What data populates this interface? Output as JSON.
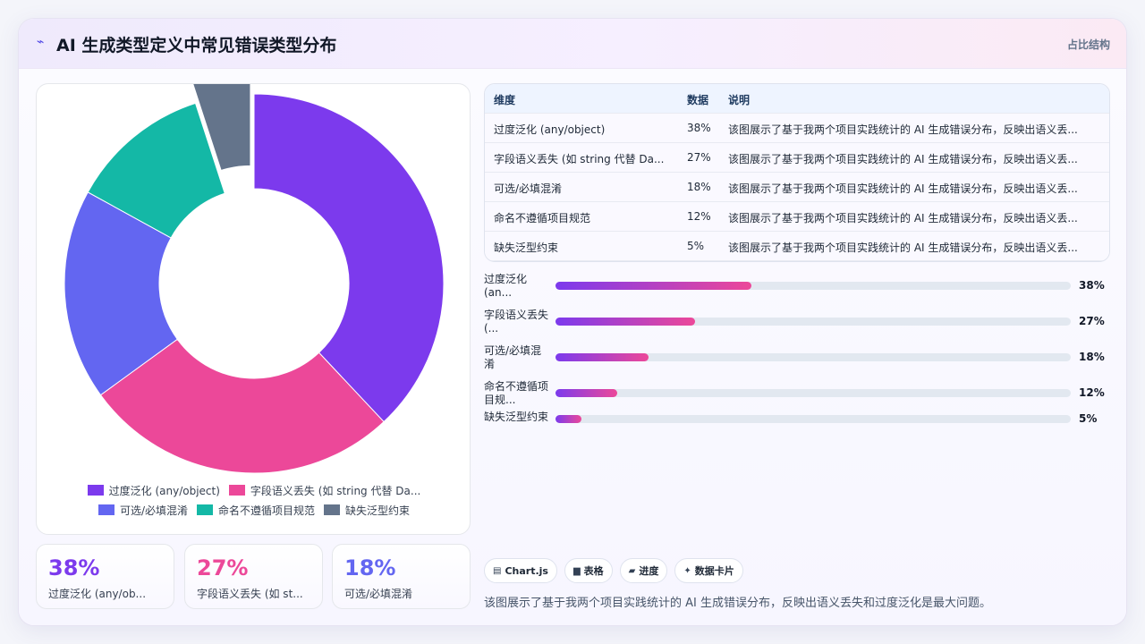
{
  "header": {
    "title": "AI 生成类型定义中常见错误类型分布",
    "badge": "占比结构",
    "logo_icon": "sparkle-icon"
  },
  "colors": {
    "accent": "#7c3aed",
    "pink": "#ec4899",
    "indigo": "#6366f1",
    "teal": "#14b8a6",
    "slate": "#64748b"
  },
  "chart_data": {
    "type": "pie",
    "variant": "doughnut",
    "categories": [
      "过度泛化 (any/object)",
      "字段语义丢失 (如 string 代替 Da...",
      "可选/必填混淆",
      "命名不遵循项目规范",
      "缺失泛型约束"
    ],
    "values": [
      38,
      27,
      18,
      12,
      5
    ],
    "colors": [
      "#7c3aed",
      "#ec4899",
      "#6366f1",
      "#14b8a6",
      "#64748b"
    ],
    "legend_labels": [
      "过度泛化 (any/object)",
      "字段语义丢失 (如 string 代替 Da...",
      "可选/必填混淆",
      "命名不遵循项目规范",
      "缺失泛型约束"
    ],
    "legend_position": "bottom",
    "highlight_offset_index": 4,
    "title": ""
  },
  "stats": [
    {
      "value": "38%",
      "label": "过度泛化 (any/ob...",
      "color": "#7c3aed"
    },
    {
      "value": "27%",
      "label": "字段语义丢失 (如 st...",
      "color": "#ec4899"
    },
    {
      "value": "18%",
      "label": "可选/必填混淆",
      "color": "#6366f1"
    }
  ],
  "table": {
    "headers": [
      "维度",
      "数据",
      "说明"
    ],
    "rows": [
      [
        "过度泛化 (any/object)",
        "38%",
        "该图展示了基于我两个项目实践统计的 AI 生成错误分布，反映出语义丢..."
      ],
      [
        "字段语义丢失 (如 string 代替 Da...",
        "27%",
        "该图展示了基于我两个项目实践统计的 AI 生成错误分布，反映出语义丢..."
      ],
      [
        "可选/必填混淆",
        "18%",
        "该图展示了基于我两个项目实践统计的 AI 生成错误分布，反映出语义丢..."
      ],
      [
        "命名不遵循项目规范",
        "12%",
        "该图展示了基于我两个项目实践统计的 AI 生成错误分布，反映出语义丢..."
      ],
      [
        "缺失泛型约束",
        "5%",
        "该图展示了基于我两个项目实践统计的 AI 生成错误分布，反映出语义丢..."
      ]
    ]
  },
  "progress": [
    {
      "label": "过度泛化 (an...",
      "value": 38,
      "display": "38%"
    },
    {
      "label": "字段语义丢失 (...",
      "value": 27,
      "display": "27%"
    },
    {
      "label": "可选/必填混淆",
      "value": 18,
      "display": "18%"
    },
    {
      "label": "命名不遵循项目规...",
      "value": 12,
      "display": "12%"
    },
    {
      "label": "缺失泛型约束",
      "value": 5,
      "display": "5%"
    }
  ],
  "chips": [
    {
      "label": "Chart.js",
      "icon": "chart-icon",
      "glyph": "▤"
    },
    {
      "label": "表格",
      "icon": "table-icon",
      "glyph": "▆"
    },
    {
      "label": "进度",
      "icon": "progress-icon",
      "glyph": "▰"
    },
    {
      "label": "数据卡片",
      "icon": "sparkle-icon",
      "glyph": "✦"
    }
  ],
  "footnote": "该图展示了基于我两个项目实践统计的 AI 生成错误分布，反映出语义丢失和过度泛化是最大问题。"
}
